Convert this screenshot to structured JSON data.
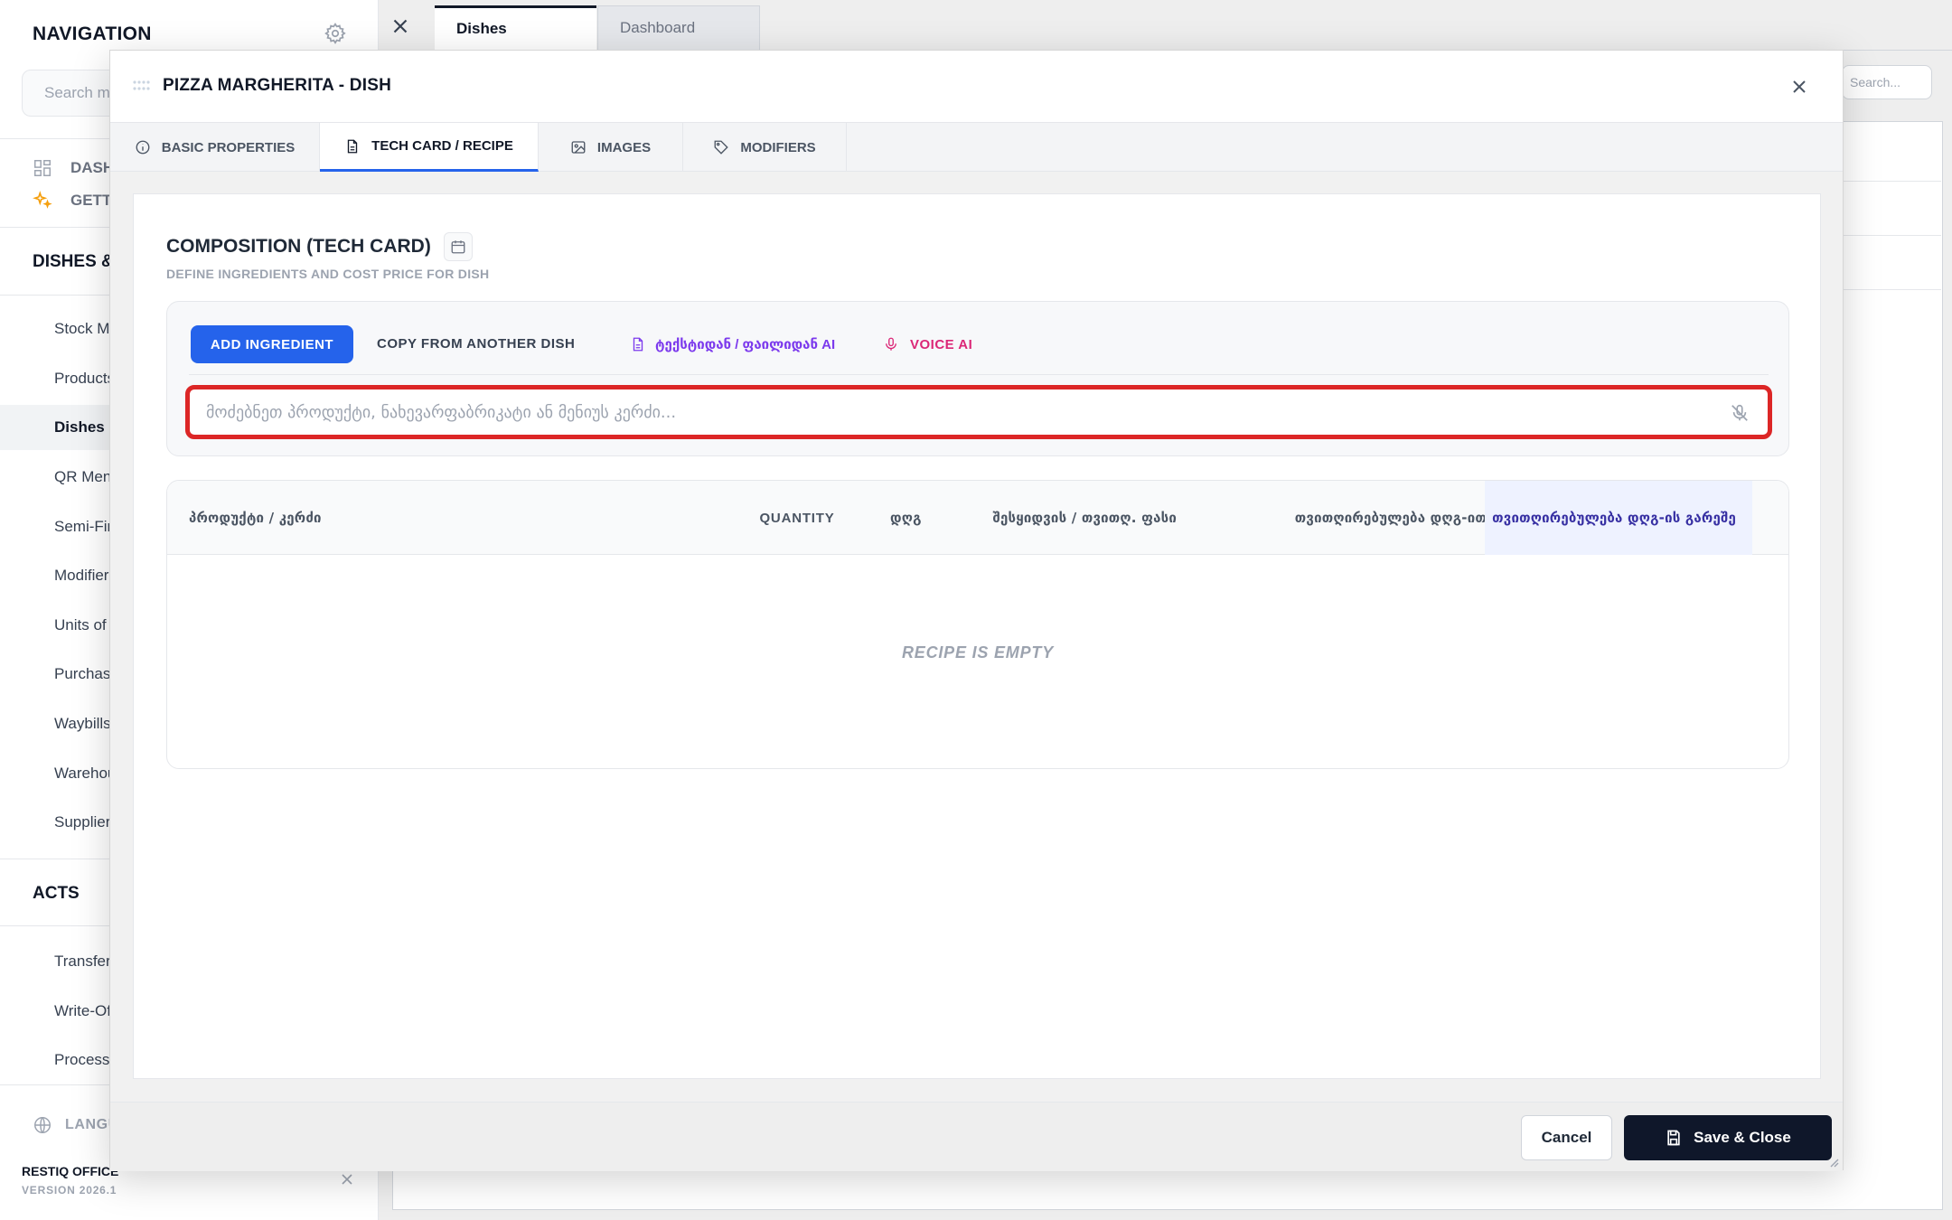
{
  "sidebar": {
    "title": "NAVIGATION",
    "search_placeholder": "Search menu...",
    "top_items": [
      {
        "label": "DASHBOARD"
      },
      {
        "label": "GETTING STARTED"
      }
    ],
    "section_dishes": "DISHES & PRODUCTS",
    "items": [
      "Stock Management",
      "Products",
      "Dishes",
      "QR Menu",
      "Semi-Finished",
      "Modifiers",
      "Units of Measure",
      "Purchases",
      "Waybills",
      "Warehouses",
      "Suppliers"
    ],
    "section_acts": "ACTS",
    "acts_items": [
      "Transfers",
      "Write-Offs",
      "Processing"
    ],
    "language_label": "LANGUAGE",
    "brand": "RESTIQ OFFICE",
    "version": "VERSION 2026.1"
  },
  "top_tabs": [
    {
      "label": "Dishes",
      "active": true
    },
    {
      "label": "Dashboard",
      "active": false
    }
  ],
  "background": {
    "search_placeholder": "Search..."
  },
  "modal": {
    "title": "PIZZA MARGHERITA - DISH",
    "tabs": [
      {
        "label": "BASIC PROPERTIES",
        "icon": "info-icon"
      },
      {
        "label": "TECH CARD / RECIPE",
        "icon": "document-icon",
        "active": true
      },
      {
        "label": "IMAGES",
        "icon": "image-icon"
      },
      {
        "label": "MODIFIERS",
        "icon": "tag-icon"
      }
    ],
    "section_title": "COMPOSITION (TECH CARD)",
    "section_subtitle": "DEFINE INGREDIENTS AND COST PRICE FOR DISH",
    "toolbar": {
      "add_ingredient": "ADD INGREDIENT",
      "copy_from": "COPY FROM ANOTHER DISH",
      "ai_text": "ტექსტიდან / ფაილიდან AI",
      "voice_ai": "VOICE AI"
    },
    "search": {
      "placeholder": "მოძებნეთ პროდუქტი, ნახევარფაბრიკატი ან მენიუს კერძი...",
      "value": ""
    },
    "table": {
      "columns": [
        "პროდუქტი / კერძი",
        "QUANTITY",
        "დღგ",
        "შესყიდვის / თვითღ. ფასი",
        "თვითღირებულება დღგ-ით",
        "თვითღირებულება დღგ-ის გარეშე"
      ],
      "rows": [],
      "empty_message": "RECIPE IS EMPTY"
    },
    "footer": {
      "cancel": "Cancel",
      "save": "Save & Close"
    }
  },
  "colors": {
    "primary": "#2563eb",
    "dark": "#0f172a",
    "highlight_border": "#dc2626",
    "ai_purple": "#7c3aed",
    "voice_pink": "#db2777"
  }
}
